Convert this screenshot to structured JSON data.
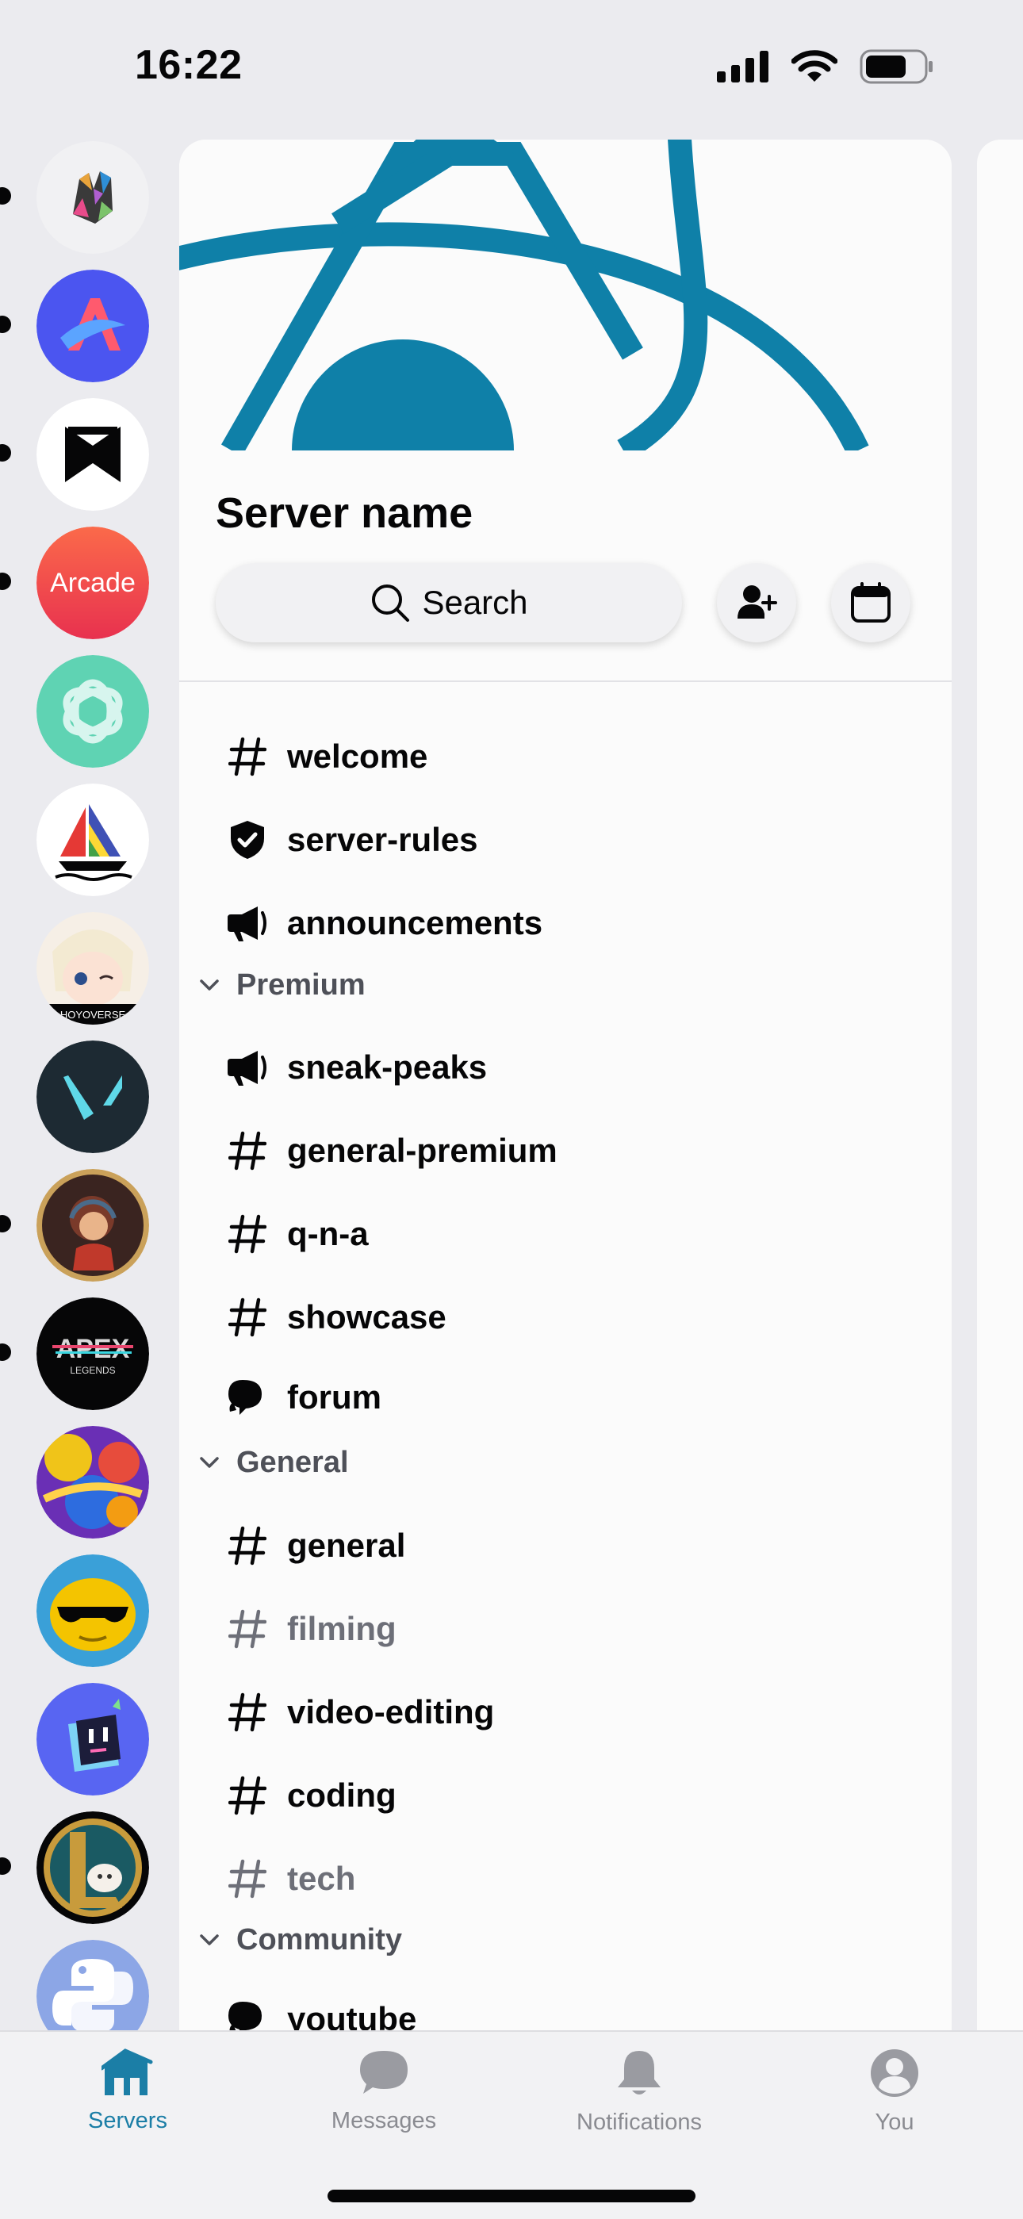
{
  "status_bar": {
    "time": "16:22"
  },
  "servers": [
    {
      "name": "colorful-logo-server",
      "unread": true
    },
    {
      "name": "arc-server",
      "unread": true
    },
    {
      "name": "bowtie-logo-server",
      "unread": true
    },
    {
      "name": "apple-arcade-server",
      "label": "Arcade",
      "unread": true
    },
    {
      "name": "openai-server",
      "unread": false
    },
    {
      "name": "midjourney-server",
      "unread": false
    },
    {
      "name": "hoyoverse-server",
      "label": "HOYOVERSE",
      "unread": false
    },
    {
      "name": "valorant-server",
      "unread": false
    },
    {
      "name": "lofi-girl-server",
      "unread": true
    },
    {
      "name": "apex-legends-server",
      "label": "APEX",
      "sublabel": "LEGENDS",
      "unread": true
    },
    {
      "name": "jojo-server",
      "unread": false
    },
    {
      "name": "sunglasses-emoji-server",
      "unread": false
    },
    {
      "name": "bot-server",
      "unread": false
    },
    {
      "name": "league-of-legends-server",
      "unread": true
    },
    {
      "name": "python-server",
      "unread": false
    }
  ],
  "server": {
    "name": "Server name",
    "search_label": "Search",
    "banner_color": "#0f80a8"
  },
  "channels": [
    {
      "type": "text",
      "label": "welcome",
      "muted": false
    },
    {
      "type": "rules",
      "label": "server-rules",
      "muted": false
    },
    {
      "type": "announcement",
      "label": "announcements",
      "muted": false
    },
    {
      "type": "category",
      "label": "Premium"
    },
    {
      "type": "announcement",
      "label": "sneak-peaks",
      "muted": false
    },
    {
      "type": "text",
      "label": "general-premium",
      "muted": false
    },
    {
      "type": "text",
      "label": "q-n-a",
      "muted": false
    },
    {
      "type": "text",
      "label": "showcase",
      "muted": false
    },
    {
      "type": "forum",
      "label": "forum",
      "muted": false
    },
    {
      "type": "category",
      "label": "General"
    },
    {
      "type": "text",
      "label": "general",
      "muted": false
    },
    {
      "type": "text",
      "label": "filming",
      "muted": true
    },
    {
      "type": "text",
      "label": "video-editing",
      "muted": false
    },
    {
      "type": "text",
      "label": "coding",
      "muted": false
    },
    {
      "type": "text",
      "label": "tech",
      "muted": true
    },
    {
      "type": "category",
      "label": "Community"
    },
    {
      "type": "forum",
      "label": "youtube",
      "muted": false
    }
  ],
  "tabs": [
    {
      "label": "Servers",
      "icon": "servers-icon",
      "active": true
    },
    {
      "label": "Messages",
      "icon": "messages-icon",
      "active": false
    },
    {
      "label": "Notifications",
      "icon": "bell-icon",
      "active": false
    },
    {
      "label": "You",
      "icon": "profile-icon",
      "active": false
    }
  ],
  "colors": {
    "accent": "#1b7ea6",
    "inactive_tab": "#8a8b91",
    "muted_channel": "#6d6f78"
  }
}
